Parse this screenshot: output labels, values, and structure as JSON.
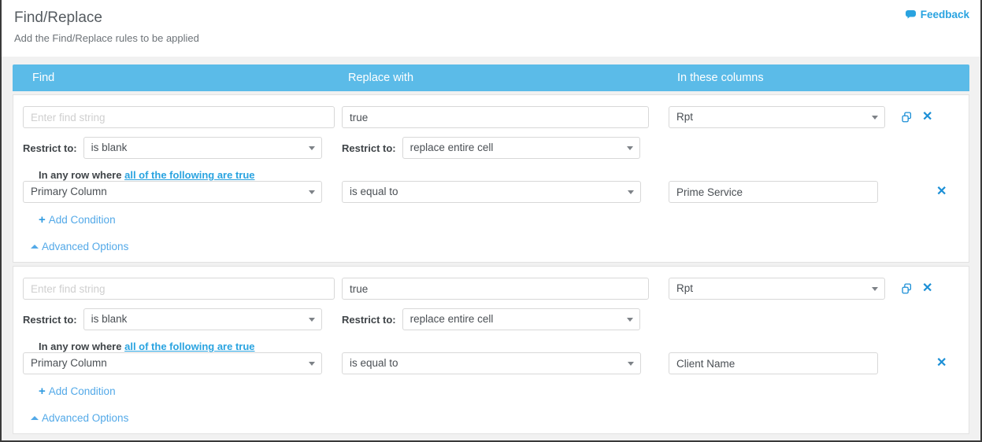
{
  "header": {
    "title": "Find/Replace",
    "subtitle": "Add the Find/Replace rules to be applied",
    "feedback_label": "Feedback",
    "feedback_icon": "comment-bubble-icon",
    "link_color": "#29a3e0"
  },
  "columns": {
    "find": "Find",
    "replace": "Replace with",
    "in_columns": "In these columns",
    "bar_color": "#5bbbe8"
  },
  "labels": {
    "restrict_to": "Restrict to:",
    "in_any_row_where": "In any row where",
    "match_mode_link": "all of the following are true",
    "add_condition": "Add Condition",
    "advanced_options": "Advanced Options",
    "duplicate_icon": "duplicate-rule-icon",
    "remove_icon": "remove-rule-icon"
  },
  "placeholders": {
    "find": "Enter find string",
    "replace": "",
    "condition_value": ""
  },
  "rules": [
    {
      "find_value": "",
      "find_restrict": "is blank",
      "replace_value": "true",
      "replace_restrict": "replace entire cell",
      "columns_value": "Rpt",
      "conditions": [
        {
          "column": "Primary Column",
          "operator": "is equal to",
          "value": "Prime Service"
        }
      ]
    },
    {
      "find_value": "",
      "find_restrict": "is blank",
      "replace_value": "true",
      "replace_restrict": "replace entire cell",
      "columns_value": "Rpt",
      "conditions": [
        {
          "column": "Primary Column",
          "operator": "is equal to",
          "value": "Client Name"
        }
      ]
    }
  ]
}
